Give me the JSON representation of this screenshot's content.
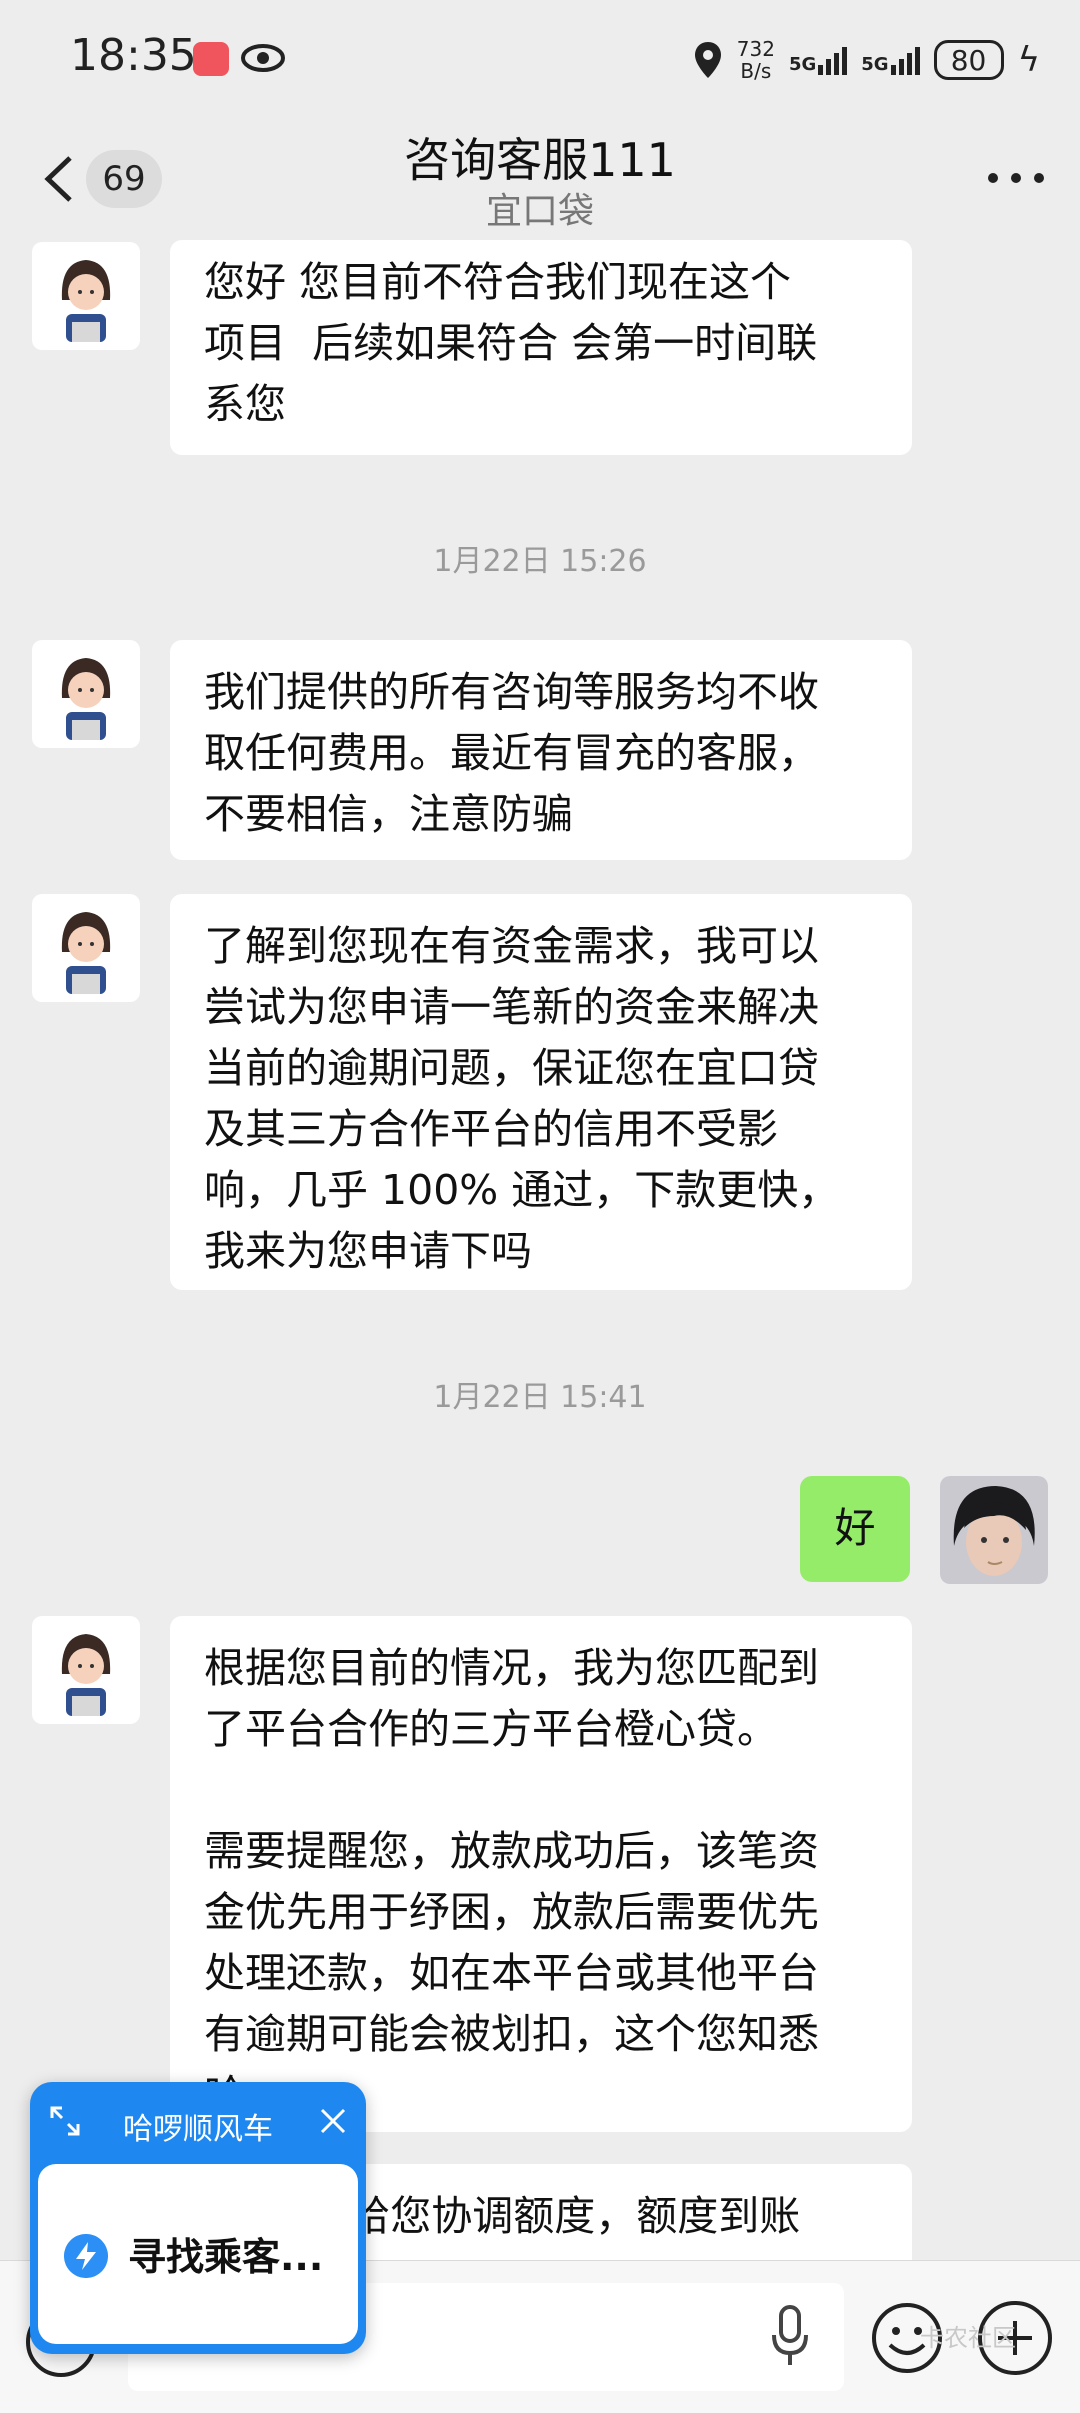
{
  "status": {
    "time": "18:35",
    "net_speed_top": "732",
    "net_speed_bottom": "B/s",
    "sim1": "5G",
    "sim2": "5G",
    "battery": "80"
  },
  "header": {
    "unread_count": "69",
    "title": "咨询客服111",
    "subtitle": "宜口袋"
  },
  "messages": [
    {
      "text": "您好 您目前不符合我们现在这个\n项目  后续如果符合 会第一时间联\n系您"
    },
    {
      "stamp": "1月22日 15:26"
    },
    {
      "text": "我们提供的所有咨询等服务均不收\n取任何费用。最近有冒充的客服，\n不要相信，注意防骗"
    },
    {
      "text": "了解到您现在有资金需求，我可以\n尝试为您申请一笔新的资金来解决\n当前的逾期问题，保证您在宜口贷\n及其三方合作平台的信用不受影\n响，几乎 100% 通过，下款更快，\n我来为您申请下吗"
    },
    {
      "stamp": "1月22日 15:41"
    },
    {
      "text": "好"
    },
    {
      "text": "根据您目前的情况，我为您匹配到\n了平台合作的三方平台橙心贷。\n\n需要提醒您，放款成功后，该笔资\n金优先用于纾困，放款后需要优先\n处理还款，如在本平台或其他平台\n有逾期可能会被划扣，这个您知悉\n哈"
    },
    {
      "text": "        来给您协调额度，额度到账"
    }
  ],
  "float_widget": {
    "title": "哈啰顺风车",
    "status": "寻找乘客..."
  },
  "watermark": "卡农社区"
}
